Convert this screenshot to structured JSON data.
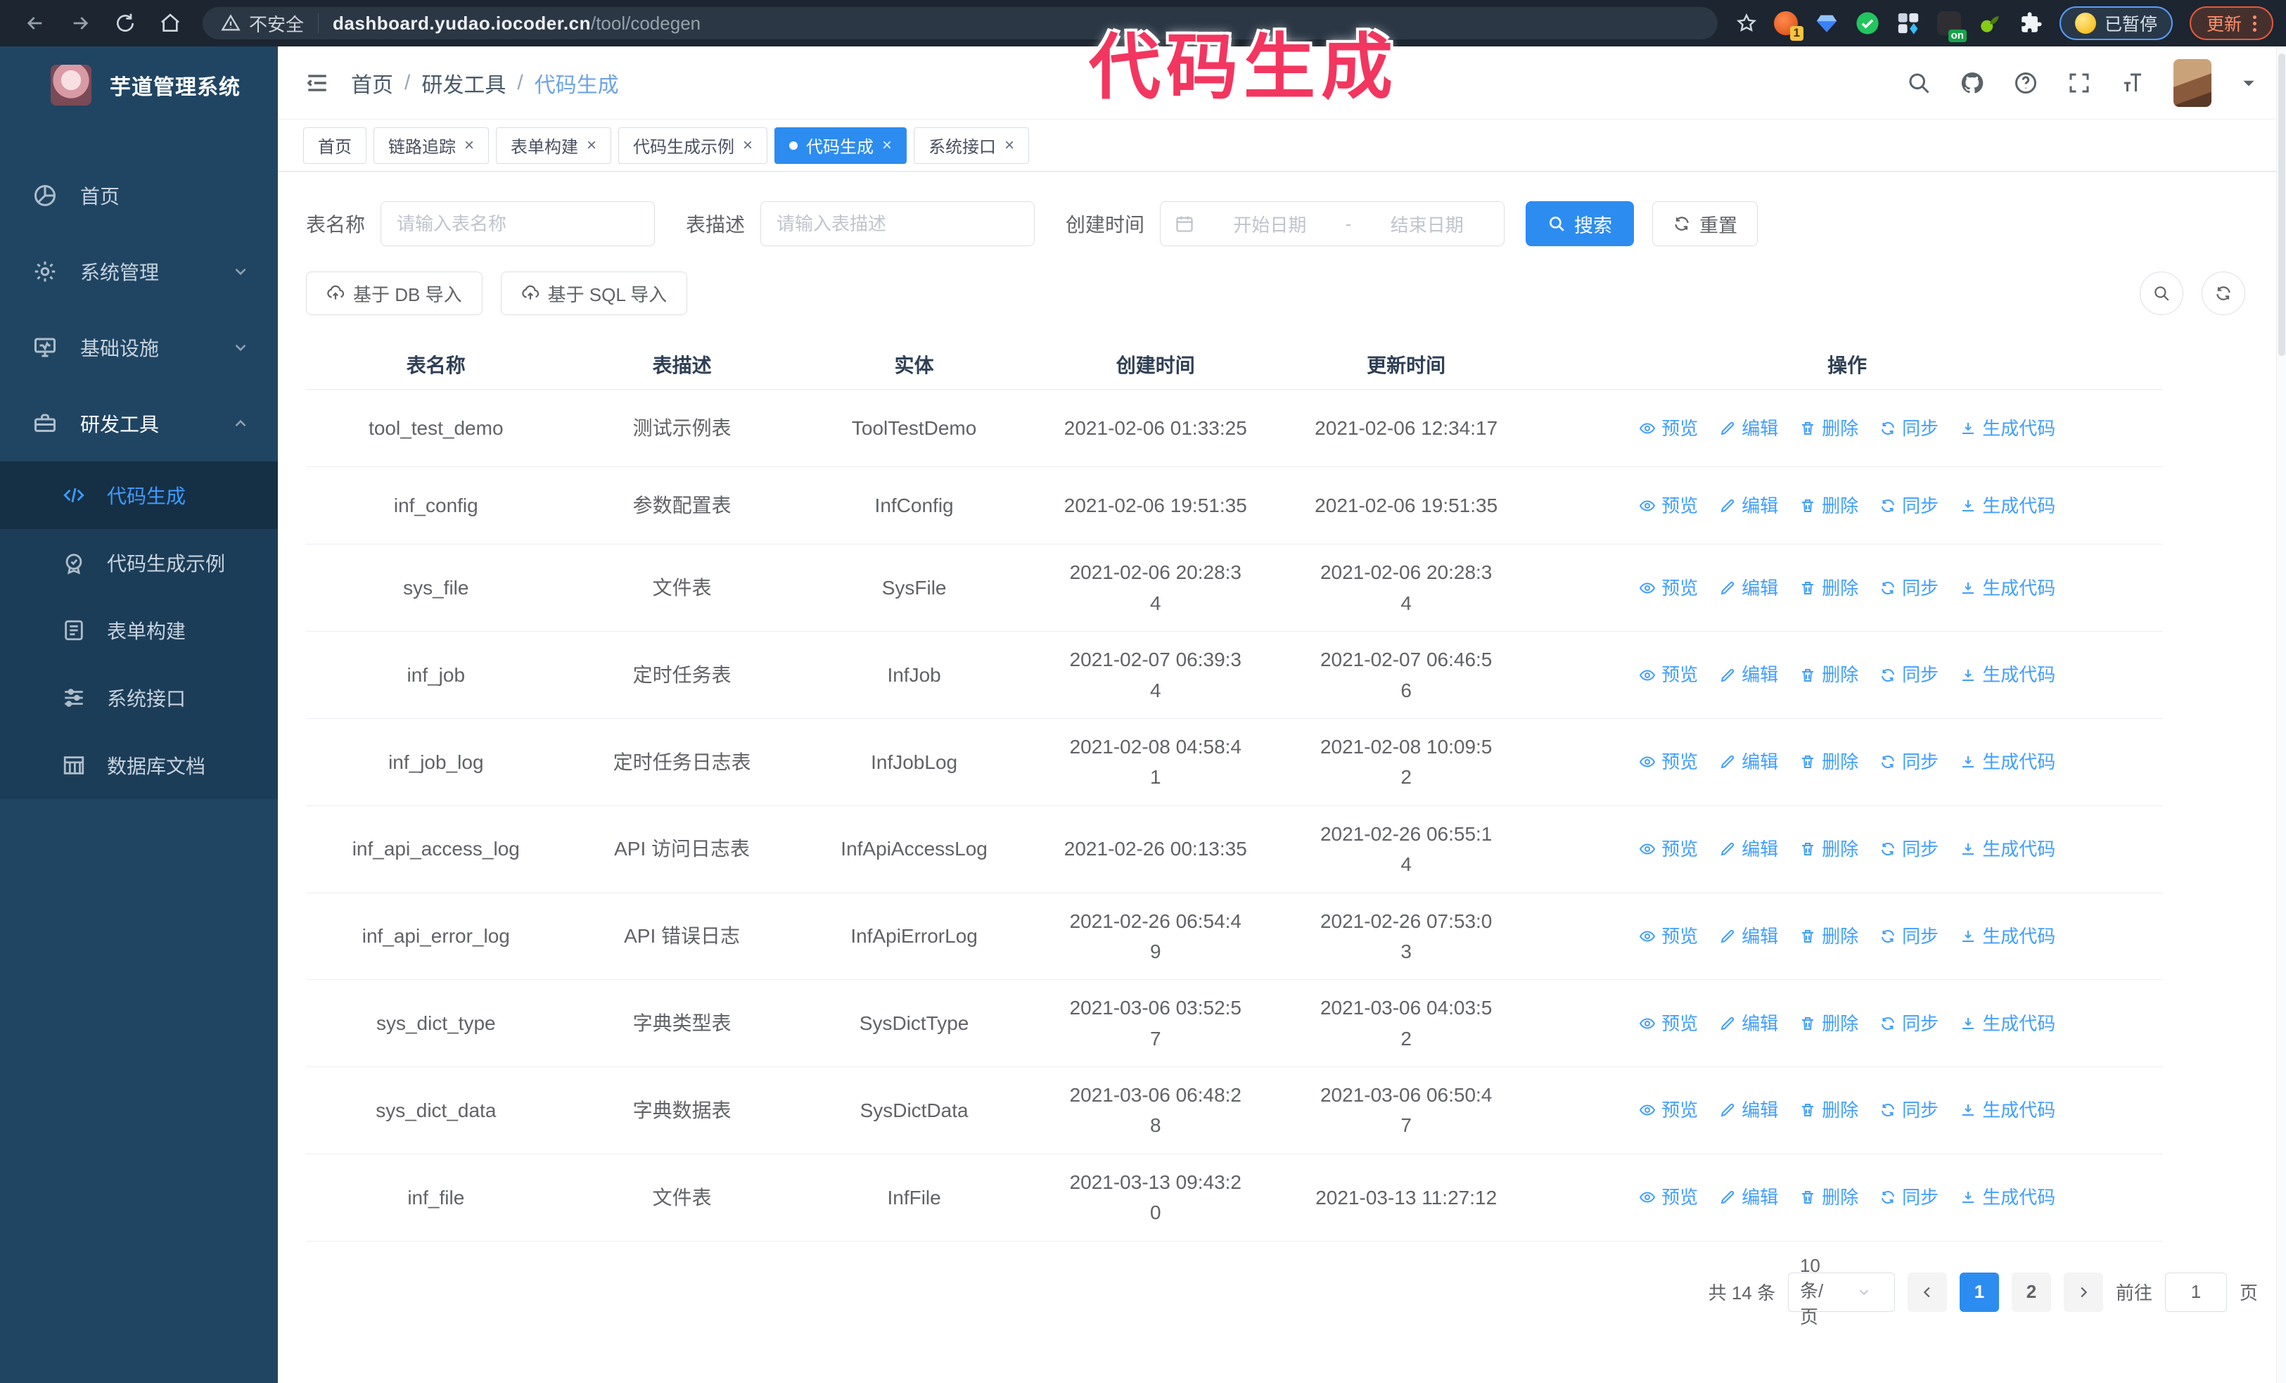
{
  "colors": {
    "accent": "#2d8cf0",
    "link": "#409eff",
    "sidebar_bg": "#204563",
    "chrome_bg": "#1c2530",
    "annotation": "#f2365f"
  },
  "annotation": {
    "text": "代码生成"
  },
  "browser": {
    "security": "不安全",
    "url_domain": "dashboard.yudao.iocoder.cn",
    "url_path": "/tool/codegen",
    "ext_badge": "1",
    "ext_on": "on",
    "paused_badge": "已暂停",
    "update_button": "更新"
  },
  "sidebar": {
    "app_title": "芋道管理系统",
    "items": [
      {
        "label": "首页",
        "icon": "dashboard-icon",
        "chevron": null,
        "trail": false
      },
      {
        "label": "系统管理",
        "icon": "gear-icon",
        "chevron": "down",
        "trail": false
      },
      {
        "label": "基础设施",
        "icon": "infra-icon",
        "chevron": "down",
        "trail": false
      },
      {
        "label": "研发工具",
        "icon": "tools-icon",
        "chevron": "up",
        "trail": true
      }
    ],
    "subitems": [
      {
        "label": "代码生成",
        "icon": "code-icon",
        "active": true
      },
      {
        "label": "代码生成示例",
        "icon": "example-icon",
        "active": false
      },
      {
        "label": "表单构建",
        "icon": "form-icon",
        "active": false
      },
      {
        "label": "系统接口",
        "icon": "api-icon",
        "active": false
      },
      {
        "label": "数据库文档",
        "icon": "dbdoc-icon",
        "active": false
      }
    ]
  },
  "header": {
    "breadcrumb": [
      "首页",
      "研发工具",
      "代码生成"
    ]
  },
  "tabs": [
    {
      "label": "首页",
      "closable": false,
      "active": false
    },
    {
      "label": "链路追踪",
      "closable": true,
      "active": false
    },
    {
      "label": "表单构建",
      "closable": true,
      "active": false
    },
    {
      "label": "代码生成示例",
      "closable": true,
      "active": false
    },
    {
      "label": "代码生成",
      "closable": true,
      "active": true
    },
    {
      "label": "系统接口",
      "closable": true,
      "active": false
    }
  ],
  "filters": {
    "name_label": "表名称",
    "name_placeholder": "请输入表名称",
    "desc_label": "表描述",
    "desc_placeholder": "请输入表描述",
    "time_label": "创建时间",
    "start_placeholder": "开始日期",
    "range_separator": "-",
    "end_placeholder": "结束日期",
    "search_label": "搜索",
    "reset_label": "重置"
  },
  "toolbar": {
    "import_db_label": "基于 DB 导入",
    "import_sql_label": "基于 SQL 导入"
  },
  "table": {
    "columns": [
      "表名称",
      "表描述",
      "实体",
      "创建时间",
      "更新时间",
      "操作"
    ],
    "actions": [
      {
        "label": "预览",
        "icon": "eye-icon",
        "name": "preview-link"
      },
      {
        "label": "编辑",
        "icon": "edit-icon",
        "name": "edit-link"
      },
      {
        "label": "删除",
        "icon": "delete-icon",
        "name": "delete-link"
      },
      {
        "label": "同步",
        "icon": "sync-icon",
        "name": "sync-link"
      },
      {
        "label": "生成代码",
        "icon": "download-icon",
        "name": "generate-code-link"
      }
    ],
    "rows": [
      {
        "name": "tool_test_demo",
        "desc": "测试示例表",
        "entity": "ToolTestDemo",
        "created": "2021-02-06 01:33:25",
        "updated": "2021-02-06 12:34:17"
      },
      {
        "name": "inf_config",
        "desc": "参数配置表",
        "entity": "InfConfig",
        "created": "2021-02-06 19:51:35",
        "updated": "2021-02-06 19:51:35"
      },
      {
        "name": "sys_file",
        "desc": "文件表",
        "entity": "SysFile",
        "created": "2021-02-06 20:28:3\n4",
        "updated": "2021-02-06 20:28:3\n4"
      },
      {
        "name": "inf_job",
        "desc": "定时任务表",
        "entity": "InfJob",
        "created": "2021-02-07 06:39:3\n4",
        "updated": "2021-02-07 06:46:5\n6"
      },
      {
        "name": "inf_job_log",
        "desc": "定时任务日志表",
        "entity": "InfJobLog",
        "created": "2021-02-08 04:58:4\n1",
        "updated": "2021-02-08 10:09:5\n2"
      },
      {
        "name": "inf_api_access_log",
        "desc": "API 访问日志表",
        "entity": "InfApiAccessLog",
        "created": "2021-02-26 00:13:35",
        "updated": "2021-02-26 06:55:1\n4"
      },
      {
        "name": "inf_api_error_log",
        "desc": "API 错误日志",
        "entity": "InfApiErrorLog",
        "created": "2021-02-26 06:54:4\n9",
        "updated": "2021-02-26 07:53:0\n3"
      },
      {
        "name": "sys_dict_type",
        "desc": "字典类型表",
        "entity": "SysDictType",
        "created": "2021-03-06 03:52:5\n7",
        "updated": "2021-03-06 04:03:5\n2"
      },
      {
        "name": "sys_dict_data",
        "desc": "字典数据表",
        "entity": "SysDictData",
        "created": "2021-03-06 06:48:2\n8",
        "updated": "2021-03-06 06:50:4\n7"
      },
      {
        "name": "inf_file",
        "desc": "文件表",
        "entity": "InfFile",
        "created": "2021-03-13 09:43:2\n0",
        "updated": "2021-03-13 11:27:12"
      }
    ]
  },
  "pagination": {
    "total": "共 14 条",
    "page_size": "10条/页",
    "pages": [
      "1",
      "2"
    ],
    "active_page": "1",
    "goto_label": "前往",
    "goto_value": "1",
    "goto_unit": "页"
  }
}
